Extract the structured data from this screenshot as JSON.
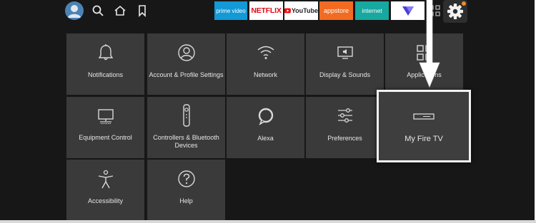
{
  "topbar": {
    "apps": [
      {
        "id": "prime",
        "label": "prime video"
      },
      {
        "id": "netflix",
        "label": "NETFLIX"
      },
      {
        "id": "youtube",
        "label": "YouTube"
      },
      {
        "id": "appstore",
        "label": "appstore"
      },
      {
        "id": "internet",
        "label": "internet"
      }
    ]
  },
  "settings": {
    "tiles": [
      {
        "label": "Notifications",
        "icon": "bell-icon"
      },
      {
        "label": "Account & Profile Settings",
        "icon": "profile-icon"
      },
      {
        "label": "Network",
        "icon": "wifi-icon"
      },
      {
        "label": "Display & Sounds",
        "icon": "display-icon"
      },
      {
        "label": "Applications",
        "icon": "apps-icon"
      },
      {
        "label": "Equipment Control",
        "icon": "tv-icon"
      },
      {
        "label": "Controllers & Bluetooth Devices",
        "icon": "remote-icon"
      },
      {
        "label": "Alexa",
        "icon": "alexa-icon"
      },
      {
        "label": "Preferences",
        "icon": "sliders-icon"
      },
      {
        "label": "Accessibility",
        "icon": "accessibility-icon"
      },
      {
        "label": "Help",
        "icon": "help-icon"
      }
    ],
    "selected": {
      "label": "My Fire TV",
      "icon": "firetv-device-icon"
    }
  },
  "colors": {
    "background": "#171717",
    "tile": "#3a3a3a",
    "highlight_border": "#f2f2f2",
    "avatar": "#4d82b4",
    "notification_dot": "#f28a2e"
  }
}
